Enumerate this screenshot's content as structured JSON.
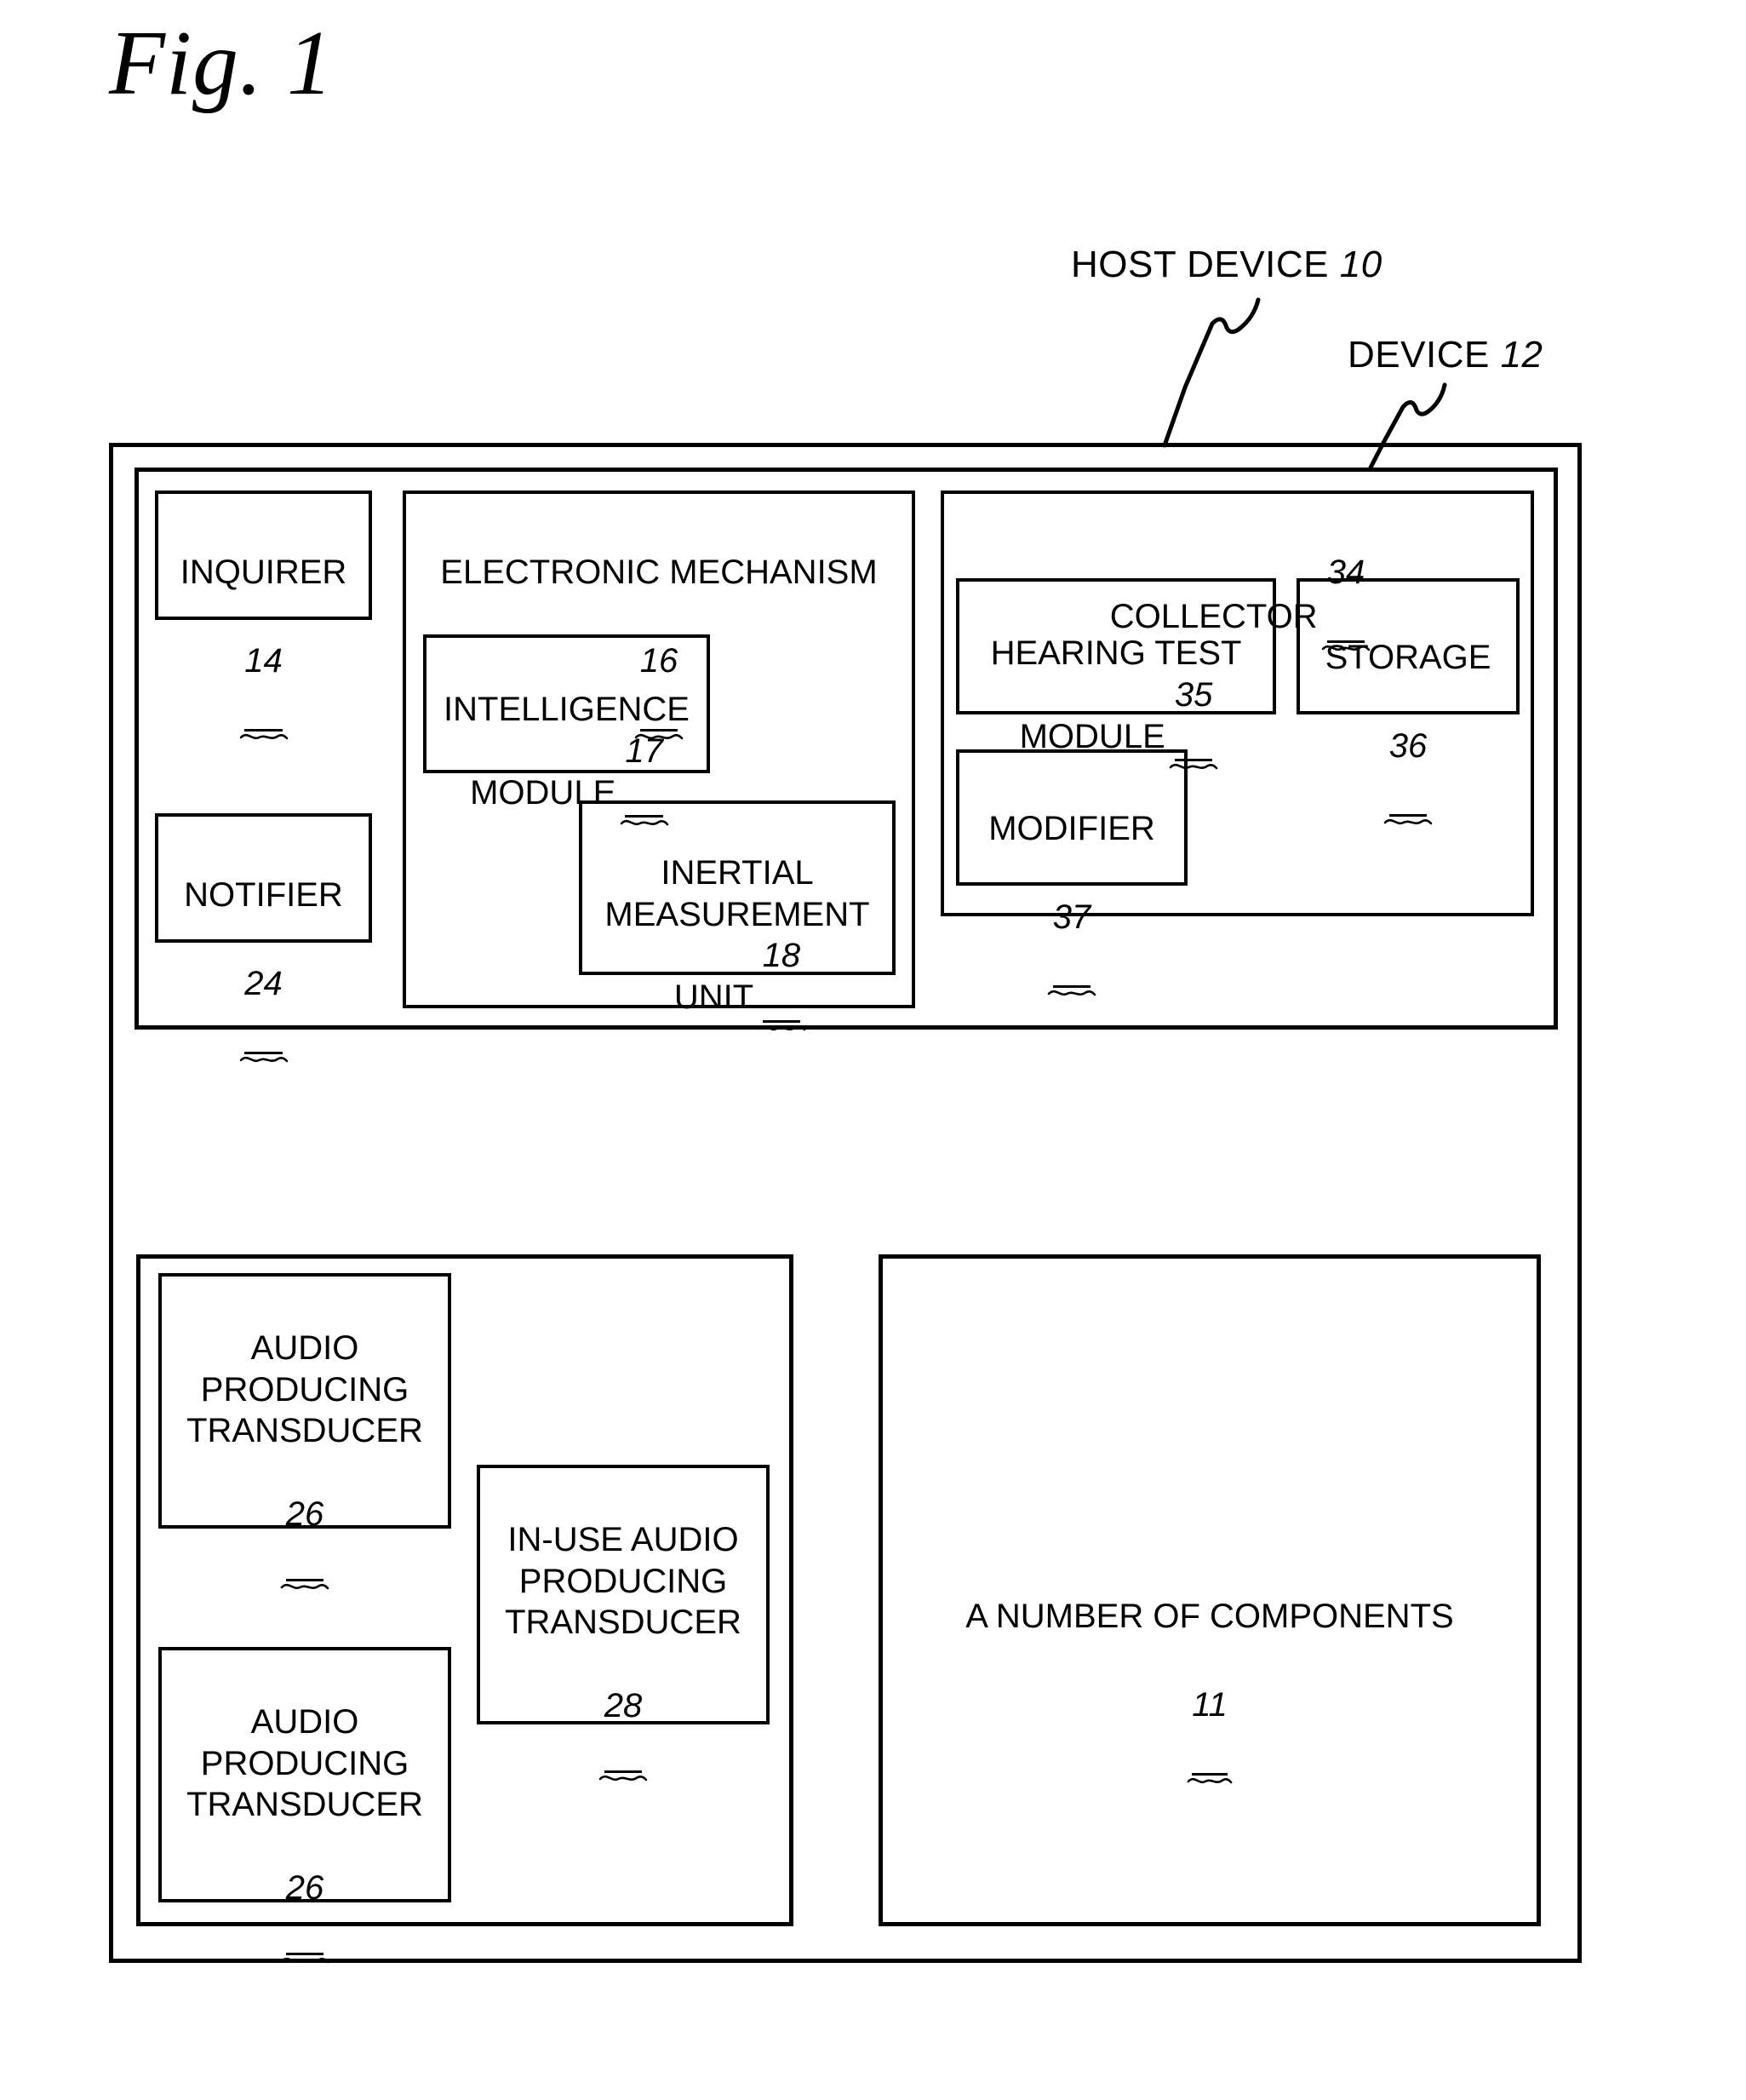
{
  "figure": {
    "title": "Fig. 1"
  },
  "callouts": [
    {
      "id": "host-device",
      "label": "HOST DEVICE",
      "number": "10"
    },
    {
      "id": "device",
      "label": "DEVICE",
      "number": "12"
    }
  ],
  "top_section": {
    "inquirer": {
      "label": "INQUIRER",
      "number": "14"
    },
    "notifier": {
      "label": "NOTIFIER",
      "number": "24"
    },
    "electronic_mechanism": {
      "label": "ELECTRONIC MECHANISM",
      "number": "16"
    },
    "intelligence_module": {
      "label": "INTELLIGENCE\nMODULE",
      "number": "17"
    },
    "inertial_measurement_unit": {
      "label": "INERTIAL\nMEASUREMENT\nUNIT",
      "number": "18"
    },
    "collector": {
      "label": "COLLECTOR",
      "number": "34"
    },
    "hearing_test_module": {
      "label": "HEARING TEST\nMODULE",
      "number": "35"
    },
    "storage": {
      "label": "STORAGE",
      "number": "36"
    },
    "modifier": {
      "label": "MODIFIER",
      "number": "37"
    }
  },
  "bottom_section": {
    "audio_transducer_top": {
      "label": "AUDIO\nPRODUCING\nTRANSDUCER",
      "number": "26"
    },
    "audio_transducer_bottom": {
      "label": "AUDIO\nPRODUCING\nTRANSDUCER",
      "number": "26"
    },
    "in_use_transducer": {
      "label": "IN-USE AUDIO\nPRODUCING\nTRANSDUCER",
      "number": "28"
    },
    "components": {
      "label": "A NUMBER OF COMPONENTS",
      "number": "11"
    }
  },
  "colors": {
    "ink": "#000000",
    "paper": "#ffffff"
  }
}
